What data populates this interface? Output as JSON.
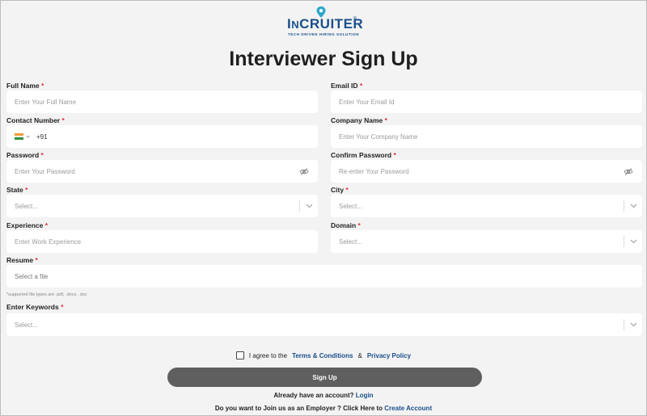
{
  "logo": {
    "brand": "InCRuiter",
    "brand_prefix": "I",
    "brand_n": "N",
    "brand_c": "C",
    "brand_rest": "RUITER",
    "registered": "®",
    "tagline": "TECH DRIVEN HIRING SOLUTION"
  },
  "page_title": "Interviewer Sign Up",
  "form": {
    "full_name": {
      "label": "Full Name",
      "placeholder": "Enter Your Full Name"
    },
    "email": {
      "label": "Email ID",
      "placeholder": "Enter Your Email Id"
    },
    "contact": {
      "label": "Contact Number",
      "code": "+91"
    },
    "company": {
      "label": "Company Name",
      "placeholder": "Enter Your Company Name"
    },
    "password": {
      "label": "Password",
      "placeholder": "Enter Your Password"
    },
    "confirm_password": {
      "label": "Confirm Password",
      "placeholder": "Re-enter Your Password"
    },
    "state": {
      "label": "State",
      "placeholder": "Select..."
    },
    "city": {
      "label": "City",
      "placeholder": "Select..."
    },
    "experience": {
      "label": "Experience",
      "placeholder": "Enter Work Experience"
    },
    "domain": {
      "label": "Domain",
      "placeholder": "Select..."
    },
    "resume": {
      "label": "Resume",
      "placeholder": "Select a file",
      "note": "*supported file types are .pdf, .docx, .doc"
    },
    "keywords": {
      "label": "Enter Keywords",
      "placeholder": "Select..."
    },
    "required_mark": "*"
  },
  "agree": {
    "prefix": "I agree to the",
    "terms": "Terms & Conditions",
    "amp": "&",
    "privacy": "Privacy Policy"
  },
  "signup_button": "Sign Up",
  "login_line": {
    "text": "Already have an account?",
    "link": "Login"
  },
  "employer_line": {
    "text": "Do you want to Join us as an Employer ? Click Here to",
    "link": "Create Account"
  },
  "colors": {
    "brand": "#1a4f8b",
    "required": "#e03030",
    "button": "#5f5f5f",
    "background": "#f3f3f3"
  },
  "icons": {
    "eye_off": "eye-off-icon",
    "chevron": "chevron-down-icon",
    "flag": "india-flag-icon"
  }
}
